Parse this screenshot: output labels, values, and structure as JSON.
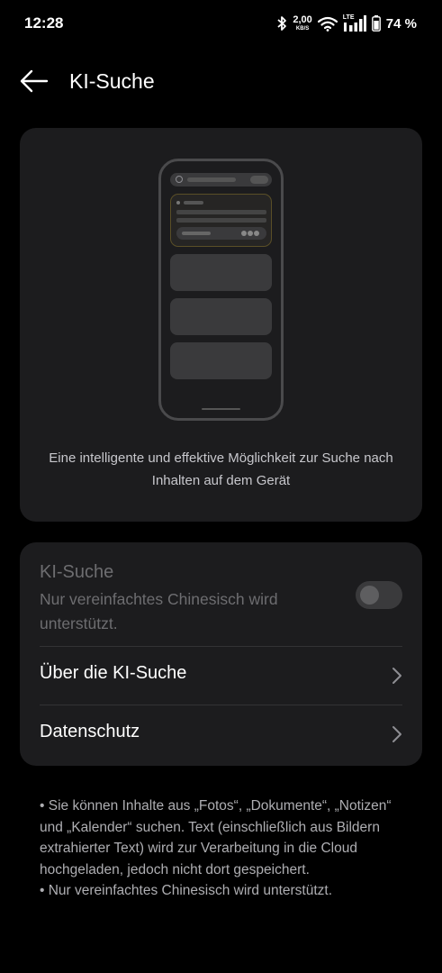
{
  "status_bar": {
    "time": "12:28",
    "net_speed_value": "2,00",
    "net_speed_unit": "KB/S",
    "lte_label": "LTE",
    "battery_percent": "74 %",
    "icons": [
      "bluetooth-icon",
      "wifi-icon",
      "signal-icon",
      "battery-icon"
    ]
  },
  "header": {
    "title": "KI-Suche",
    "back_icon": "back-arrow-icon"
  },
  "illustration": {
    "description": "Eine intelligente und effektive Möglichkeit zur Suche nach Inhalten auf dem Gerät"
  },
  "settings": {
    "ki_search": {
      "title": "KI-Suche",
      "subtitle": "Nur vereinfachtes Chinesisch wird unterstützt.",
      "toggle_on": false,
      "disabled": true
    },
    "rows": [
      {
        "label": "Über die KI-Suche",
        "icon": "chevron-right-icon"
      },
      {
        "label": "Datenschutz",
        "icon": "chevron-right-icon"
      }
    ]
  },
  "footer": {
    "note1": "• Sie können Inhalte aus „Fotos“, „Dokumente“, „Notizen“ und „Kalender“ suchen. Text (einschließlich aus Bildern extrahierter Text) wird zur Verarbeitung in die Cloud hochgeladen, jedoch nicht dort gespeichert.",
    "note2": "• Nur vereinfachtes Chinesisch wird unterstützt."
  },
  "colors": {
    "background": "#000000",
    "card": "#1c1c1e",
    "text_primary": "#ffffff",
    "text_disabled": "#6d6d70",
    "text_secondary": "#aeaeb2"
  }
}
